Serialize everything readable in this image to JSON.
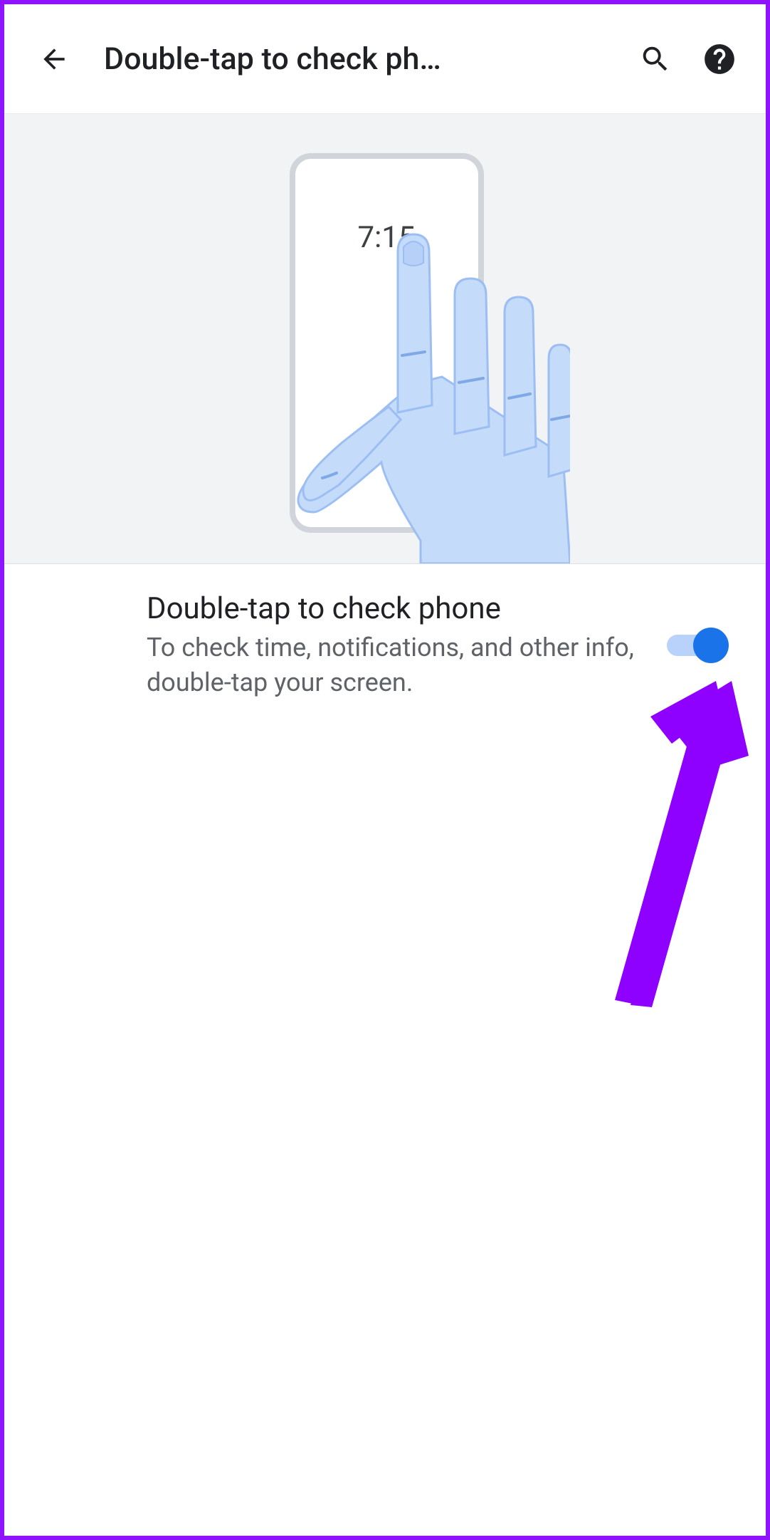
{
  "header": {
    "title": "Double-tap to check ph…"
  },
  "hero": {
    "time_display": "7:15"
  },
  "setting": {
    "title": "Double-tap to check phone",
    "description": "To check time, notifications, and other info, double-tap your screen.",
    "toggle_on": true
  }
}
